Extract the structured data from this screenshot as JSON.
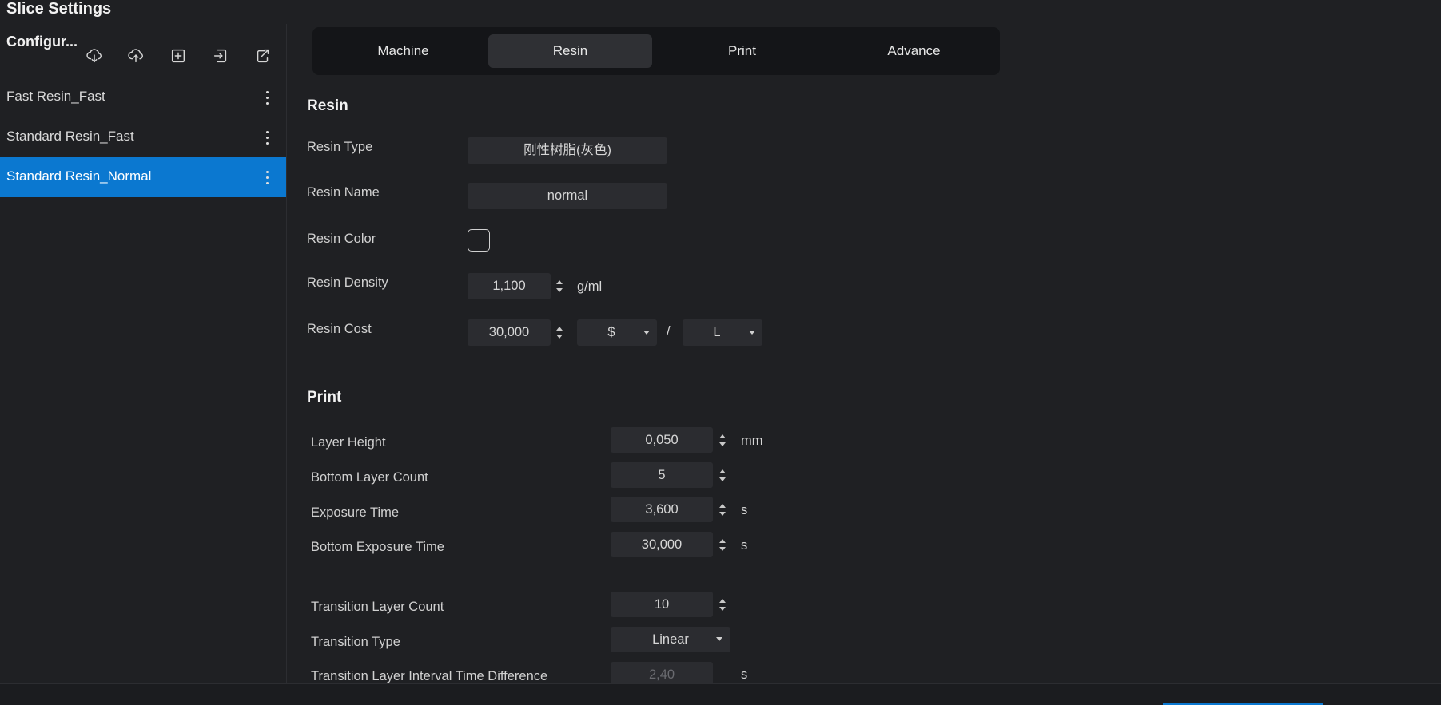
{
  "window": {
    "title": "Slice Settings"
  },
  "sidebar": {
    "header": "Configur...",
    "toolbar_icons": [
      "cloud-download-icon",
      "cloud-upload-icon",
      "add-profile-icon",
      "import-icon",
      "export-icon"
    ],
    "profiles": [
      {
        "label": "Fast Resin_Fast",
        "active": false
      },
      {
        "label": "Standard Resin_Fast",
        "active": false
      },
      {
        "label": "Standard Resin_Normal",
        "active": true
      }
    ]
  },
  "tabs": [
    {
      "label": "Machine",
      "active": false
    },
    {
      "label": "Resin",
      "active": true
    },
    {
      "label": "Print",
      "active": false
    },
    {
      "label": "Advance",
      "active": false
    }
  ],
  "resin": {
    "section_title": "Resin",
    "type_label": "Resin Type",
    "type_value": "刚性树脂(灰色)",
    "name_label": "Resin Name",
    "name_value": "normal",
    "color_label": "Resin Color",
    "color_value": "#1f2023",
    "density_label": "Resin Density",
    "density_value": "1,100",
    "density_unit": "g/ml",
    "cost_label": "Resin Cost",
    "cost_value": "30,000",
    "currency": "$",
    "per_sep": "/",
    "volume_unit": "L"
  },
  "print": {
    "section_title": "Print",
    "layer_height_label": "Layer Height",
    "layer_height_value": "0,050",
    "layer_height_unit": "mm",
    "bottom_layer_count_label": "Bottom Layer Count",
    "bottom_layer_count_value": "5",
    "exposure_time_label": "Exposure Time",
    "exposure_time_value": "3,600",
    "exposure_time_unit": "s",
    "bottom_exposure_time_label": "Bottom Exposure Time",
    "bottom_exposure_time_value": "30,000",
    "bottom_exposure_time_unit": "s",
    "transition_layer_count_label": "Transition Layer Count",
    "transition_layer_count_value": "10",
    "transition_type_label": "Transition Type",
    "transition_type_value": "Linear",
    "transition_interval_label": "Transition Layer Interval Time Difference",
    "transition_interval_value": "2,40",
    "transition_interval_unit": "s"
  },
  "colors": {
    "accent": "#0b78d0",
    "background": "#1f2023",
    "field": "#2b2c30"
  }
}
